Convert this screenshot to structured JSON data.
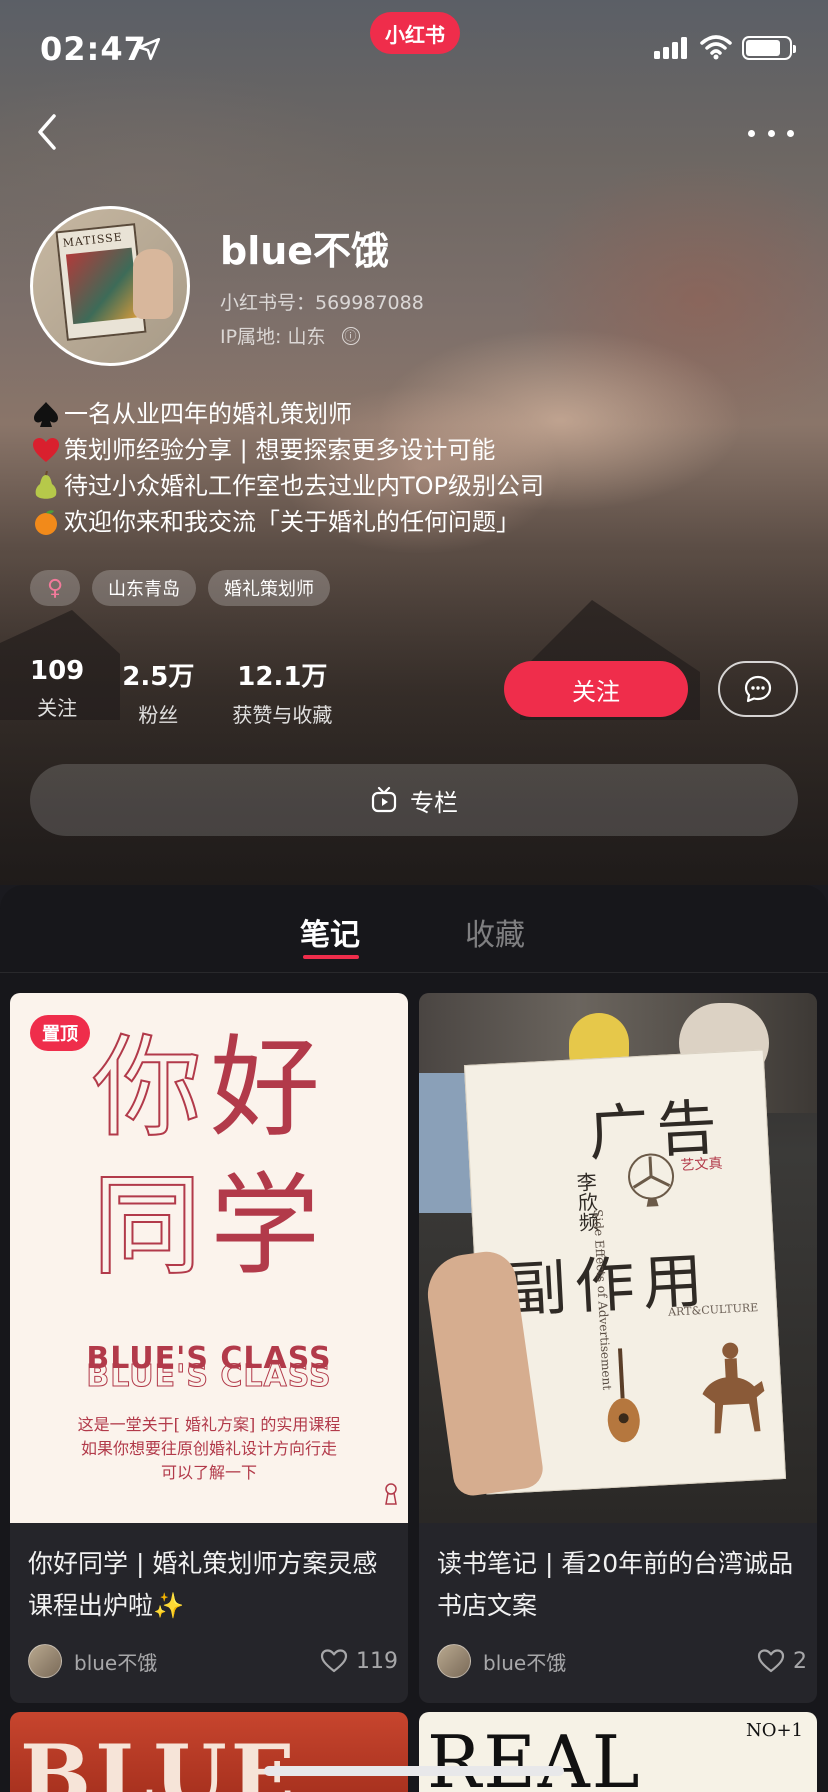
{
  "status_bar": {
    "time": "02:47"
  },
  "app_logo": "小红书",
  "profile": {
    "name": "blue不饿",
    "id_line": "小红书号：569987088",
    "ip_line": "IP属地: 山东",
    "info_icon": "ⓘ",
    "bio": [
      {
        "icon": "spade",
        "text": "一名从业四年的婚礼策划师"
      },
      {
        "icon": "heart",
        "text": "策划师经验分享 | 想要探索更多设计可能"
      },
      {
        "icon": "pear",
        "text": "待过小众婚礼工作室也去过业内TOP级别公司"
      },
      {
        "icon": "tangerine",
        "text": "欢迎你来和我交流「关于婚礼的任何问题」"
      }
    ],
    "tags": {
      "gender": "♀",
      "location": "山东青岛",
      "job": "婚礼策划师"
    },
    "stats": [
      {
        "num": "109",
        "label": "关注"
      },
      {
        "num": "2.5万",
        "label": "粉丝"
      },
      {
        "num": "12.1万",
        "label": "获赞与收藏"
      }
    ],
    "follow_label": "关注",
    "column_label": "专栏"
  },
  "tabs": [
    {
      "label": "笔记",
      "active": true
    },
    {
      "label": "收藏",
      "active": false
    }
  ],
  "notes": [
    {
      "pin_label": "置顶",
      "cover": {
        "chars": [
          "你",
          "好",
          "同",
          "学"
        ],
        "class_title": "BLUE'S CLASS",
        "desc": [
          "这是一堂关于[ 婚礼方案] 的实用课程",
          "如果你想要往原创婚礼设计方向行走",
          "可以了解一下"
        ]
      },
      "title": "你好同学 | 婚礼策划师方案灵感课程出炉啦✨",
      "author": "blue不饿",
      "likes": "119"
    },
    {
      "cover": {
        "book_title_top": "广告",
        "book_title_bottom": "副作用",
        "book_author": "李欣频",
        "book_tag": "艺文真",
        "book_en": "Side Effects of Advertisement",
        "book_edition": "ART&CULTURE"
      },
      "title": "读书笔记 | 看20年前的台湾诚品书店文案",
      "author": "blue不饿",
      "likes": "2"
    }
  ],
  "peek_cards": {
    "left_text": "BLUE",
    "right_text": "REAL",
    "right_no": "NO+1"
  },
  "colors": {
    "accent": "#ef2d4b",
    "panel": "#17171b",
    "card": "#25252a",
    "cover_red": "#b23a4a"
  }
}
